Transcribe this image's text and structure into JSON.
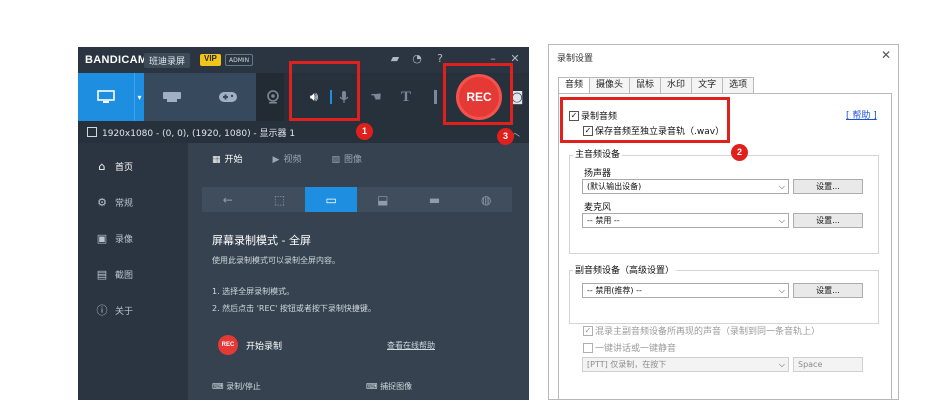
{
  "bandicam": {
    "logo": "BANDICAM",
    "app_name": "班迪录屏",
    "vip": "VIP",
    "admin": "ADMIN",
    "rec_label": "REC",
    "info_bar": "1920x1080 - (0, 0), (1920, 1080) - 显示器 1",
    "sidebar": [
      {
        "label": "首页",
        "icon": "home-icon"
      },
      {
        "label": "常规",
        "icon": "gear-icon"
      },
      {
        "label": "录像",
        "icon": "video-icon"
      },
      {
        "label": "截图",
        "icon": "image-icon"
      },
      {
        "label": "关于",
        "icon": "info-icon"
      }
    ],
    "tabs": [
      "开始",
      "视频",
      "图像"
    ],
    "mode_title": "屏幕录制模式 - 全屏",
    "mode_desc": "使用此录制模式可以录制全屏内容。",
    "step1": "1. 选择全屏录制模式。",
    "step2": "2. 然后点击 'REC' 按钮或者按下录制快捷键。",
    "rec_mini": "REC",
    "start_record": "开始录制",
    "online_help": "查看在线帮助",
    "bottom_left": "录制/停止",
    "bottom_right": "捕捉图像",
    "badges": [
      "1",
      "3"
    ]
  },
  "dialog": {
    "title": "录制设置",
    "close": "✕",
    "tabs": [
      "音频",
      "摄像头",
      "鼠标",
      "水印",
      "文字",
      "选项"
    ],
    "record_audio": "录制音频",
    "save_wav": "保存音频至独立录音轨（.wav）",
    "help": "[ 帮助 ]",
    "badge": "2",
    "main_group": "主音频设备",
    "speaker_label": "扬声器",
    "speaker_value": "(默认输出设备)",
    "mic_label": "麦克风",
    "mic_value": "-- 禁用 --",
    "settings_btn": "设置...",
    "sub_group": "副音频设备（高级设置）",
    "sub_value": "-- 禁用(推荐) --",
    "mix_label": "混录主副音频设备所再现的声音（录制到同一条音轨上）",
    "mute_label": "一键讲话或一键静音",
    "ptt_value": "[PTT] 仅录制，在按下",
    "ptt_key": "Space"
  }
}
